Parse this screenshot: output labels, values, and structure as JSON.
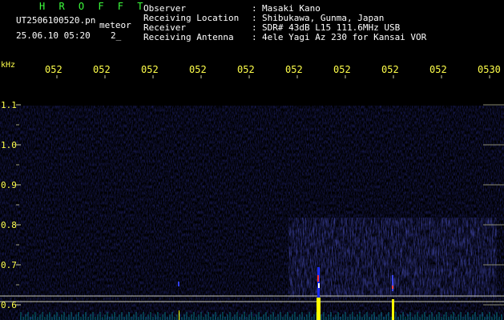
{
  "header": {
    "program": "H R O F F T",
    "filename": "UT2506100520.pn",
    "mode": "meteor",
    "datetime": "25.06.10 05:20",
    "index": "2_",
    "info_labels": [
      "Observer",
      "Receiving Location",
      "Receiver",
      "Receiving Antenna"
    ],
    "info_colons": [
      ":",
      ":",
      ":",
      ":"
    ],
    "info_values": [
      "Masaki Kano",
      "Shibukawa, Gunma, Japan",
      "SDR# 43dB L15 111.6MHz USB",
      "4ele Yagi Az 230 for Kansai VOR"
    ]
  },
  "plot": {
    "y_unit": "kHz",
    "y_ticks": [
      "1.1",
      "1.0",
      "0.9",
      "0.8",
      "0.7",
      "0.6"
    ],
    "time_ticks": [
      "052",
      "052",
      "052",
      "052",
      "052",
      "052",
      "052",
      "052",
      "052",
      "0530"
    ],
    "colors": {
      "background": "#000000",
      "text": "#ffffff",
      "tick_labels": "#ffff4a",
      "title": "#3cff3c",
      "echo": "#ffff00"
    }
  }
}
